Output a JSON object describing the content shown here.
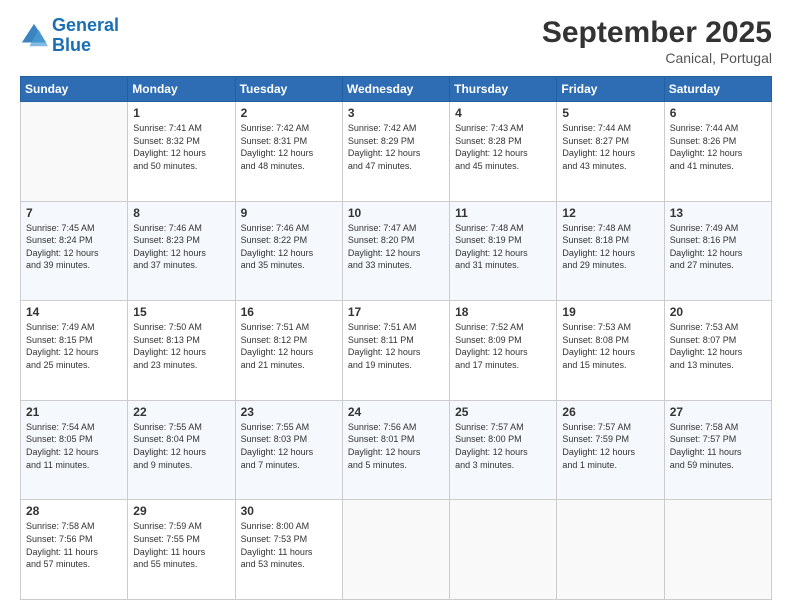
{
  "header": {
    "logo_line1": "General",
    "logo_line2": "Blue",
    "month_title": "September 2025",
    "subtitle": "Canical, Portugal"
  },
  "weekdays": [
    "Sunday",
    "Monday",
    "Tuesday",
    "Wednesday",
    "Thursday",
    "Friday",
    "Saturday"
  ],
  "weeks": [
    [
      {
        "day": "",
        "text": ""
      },
      {
        "day": "1",
        "text": "Sunrise: 7:41 AM\nSunset: 8:32 PM\nDaylight: 12 hours\nand 50 minutes."
      },
      {
        "day": "2",
        "text": "Sunrise: 7:42 AM\nSunset: 8:31 PM\nDaylight: 12 hours\nand 48 minutes."
      },
      {
        "day": "3",
        "text": "Sunrise: 7:42 AM\nSunset: 8:29 PM\nDaylight: 12 hours\nand 47 minutes."
      },
      {
        "day": "4",
        "text": "Sunrise: 7:43 AM\nSunset: 8:28 PM\nDaylight: 12 hours\nand 45 minutes."
      },
      {
        "day": "5",
        "text": "Sunrise: 7:44 AM\nSunset: 8:27 PM\nDaylight: 12 hours\nand 43 minutes."
      },
      {
        "day": "6",
        "text": "Sunrise: 7:44 AM\nSunset: 8:26 PM\nDaylight: 12 hours\nand 41 minutes."
      }
    ],
    [
      {
        "day": "7",
        "text": "Sunrise: 7:45 AM\nSunset: 8:24 PM\nDaylight: 12 hours\nand 39 minutes."
      },
      {
        "day": "8",
        "text": "Sunrise: 7:46 AM\nSunset: 8:23 PM\nDaylight: 12 hours\nand 37 minutes."
      },
      {
        "day": "9",
        "text": "Sunrise: 7:46 AM\nSunset: 8:22 PM\nDaylight: 12 hours\nand 35 minutes."
      },
      {
        "day": "10",
        "text": "Sunrise: 7:47 AM\nSunset: 8:20 PM\nDaylight: 12 hours\nand 33 minutes."
      },
      {
        "day": "11",
        "text": "Sunrise: 7:48 AM\nSunset: 8:19 PM\nDaylight: 12 hours\nand 31 minutes."
      },
      {
        "day": "12",
        "text": "Sunrise: 7:48 AM\nSunset: 8:18 PM\nDaylight: 12 hours\nand 29 minutes."
      },
      {
        "day": "13",
        "text": "Sunrise: 7:49 AM\nSunset: 8:16 PM\nDaylight: 12 hours\nand 27 minutes."
      }
    ],
    [
      {
        "day": "14",
        "text": "Sunrise: 7:49 AM\nSunset: 8:15 PM\nDaylight: 12 hours\nand 25 minutes."
      },
      {
        "day": "15",
        "text": "Sunrise: 7:50 AM\nSunset: 8:13 PM\nDaylight: 12 hours\nand 23 minutes."
      },
      {
        "day": "16",
        "text": "Sunrise: 7:51 AM\nSunset: 8:12 PM\nDaylight: 12 hours\nand 21 minutes."
      },
      {
        "day": "17",
        "text": "Sunrise: 7:51 AM\nSunset: 8:11 PM\nDaylight: 12 hours\nand 19 minutes."
      },
      {
        "day": "18",
        "text": "Sunrise: 7:52 AM\nSunset: 8:09 PM\nDaylight: 12 hours\nand 17 minutes."
      },
      {
        "day": "19",
        "text": "Sunrise: 7:53 AM\nSunset: 8:08 PM\nDaylight: 12 hours\nand 15 minutes."
      },
      {
        "day": "20",
        "text": "Sunrise: 7:53 AM\nSunset: 8:07 PM\nDaylight: 12 hours\nand 13 minutes."
      }
    ],
    [
      {
        "day": "21",
        "text": "Sunrise: 7:54 AM\nSunset: 8:05 PM\nDaylight: 12 hours\nand 11 minutes."
      },
      {
        "day": "22",
        "text": "Sunrise: 7:55 AM\nSunset: 8:04 PM\nDaylight: 12 hours\nand 9 minutes."
      },
      {
        "day": "23",
        "text": "Sunrise: 7:55 AM\nSunset: 8:03 PM\nDaylight: 12 hours\nand 7 minutes."
      },
      {
        "day": "24",
        "text": "Sunrise: 7:56 AM\nSunset: 8:01 PM\nDaylight: 12 hours\nand 5 minutes."
      },
      {
        "day": "25",
        "text": "Sunrise: 7:57 AM\nSunset: 8:00 PM\nDaylight: 12 hours\nand 3 minutes."
      },
      {
        "day": "26",
        "text": "Sunrise: 7:57 AM\nSunset: 7:59 PM\nDaylight: 12 hours\nand 1 minute."
      },
      {
        "day": "27",
        "text": "Sunrise: 7:58 AM\nSunset: 7:57 PM\nDaylight: 11 hours\nand 59 minutes."
      }
    ],
    [
      {
        "day": "28",
        "text": "Sunrise: 7:58 AM\nSunset: 7:56 PM\nDaylight: 11 hours\nand 57 minutes."
      },
      {
        "day": "29",
        "text": "Sunrise: 7:59 AM\nSunset: 7:55 PM\nDaylight: 11 hours\nand 55 minutes."
      },
      {
        "day": "30",
        "text": "Sunrise: 8:00 AM\nSunset: 7:53 PM\nDaylight: 11 hours\nand 53 minutes."
      },
      {
        "day": "",
        "text": ""
      },
      {
        "day": "",
        "text": ""
      },
      {
        "day": "",
        "text": ""
      },
      {
        "day": "",
        "text": ""
      }
    ]
  ]
}
